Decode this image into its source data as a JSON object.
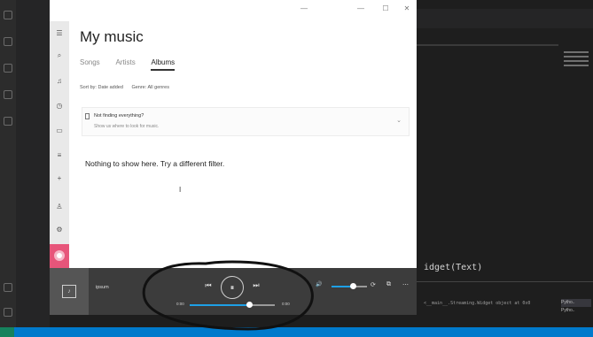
{
  "groove": {
    "window_controls": {
      "minimize": "—",
      "maximize": "☐",
      "close": "✕"
    },
    "nav_items": [
      {
        "icon": "hamburger-icon",
        "glyph": "☰"
      },
      {
        "icon": "search-icon",
        "glyph": "⌕"
      },
      {
        "icon": "music-note-icon",
        "glyph": "♫"
      },
      {
        "icon": "recent-icon",
        "glyph": "◷"
      },
      {
        "icon": "now-playing-icon",
        "glyph": "▭"
      },
      {
        "icon": "playlist-icon",
        "glyph": "≡"
      },
      {
        "icon": "add-icon",
        "glyph": "+"
      },
      {
        "icon": "person-icon",
        "glyph": "♙"
      },
      {
        "icon": "settings-icon",
        "glyph": "⚙"
      }
    ],
    "title": "My music",
    "tabs": [
      {
        "label": "Songs",
        "active": false
      },
      {
        "label": "Artists",
        "active": false
      },
      {
        "label": "Albums",
        "active": true
      }
    ],
    "filters": {
      "sort": "Sort by: Date added",
      "genre": "Genre: All genres"
    },
    "banner": {
      "heading": "Not finding everything?",
      "subtext": "Show us where to look for music."
    },
    "empty_message": "Nothing to show here. Try a different filter."
  },
  "player": {
    "track": "ipsum",
    "time_elapsed": "0:00",
    "time_total": "0:00",
    "progress": 0.7,
    "volume": 0.6,
    "icons": {
      "prev": "⏮",
      "play_pause": "⏸",
      "next": "⏭",
      "volume": "🔊",
      "repeat": "⟳",
      "miniview": "⧉",
      "more": "⋯",
      "album_art": "♪"
    }
  },
  "vscode": {
    "code_line": "idget(Text)",
    "terminal_line": "<__main__.Streaming.Widget object at 0x0",
    "terminal_list": [
      "Pytho..",
      "Pytho.."
    ]
  },
  "colors": {
    "accent": "#1ea0e6",
    "profile": "#e7557a",
    "statusbar": "#007acc",
    "player_bg": "#3c3c3c"
  }
}
